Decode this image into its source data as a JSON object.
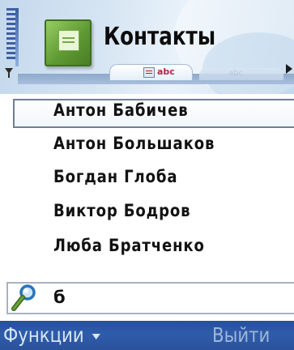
{
  "header": {
    "title": "Контакты",
    "app_icon": "contacts-book-icon",
    "signal_icon": "signal-strength-icon",
    "antenna_icon": "antenna-icon"
  },
  "tabs": {
    "active_label": "abc",
    "active_icon": "contacts-list-icon",
    "inactive_label": "abc"
  },
  "contacts": [
    {
      "name": "Антон Бабичев",
      "selected": true
    },
    {
      "name": "Антон Большаков",
      "selected": false
    },
    {
      "name": "Богдан Глоба",
      "selected": false
    },
    {
      "name": "Виктор Бодров",
      "selected": false
    },
    {
      "name": "Люба Братченко",
      "selected": false
    }
  ],
  "search": {
    "value": "б",
    "icon": "search-icon"
  },
  "softkeys": {
    "left_label": "Функции",
    "right_label": "Выйти"
  },
  "colors": {
    "softkey_bar": "#2f5caa",
    "softkey_text": "#d8e6f7",
    "header_bg": "#d6e5f3",
    "app_icon_green": "#5f9a32",
    "selection_border": "#6f7f93"
  }
}
